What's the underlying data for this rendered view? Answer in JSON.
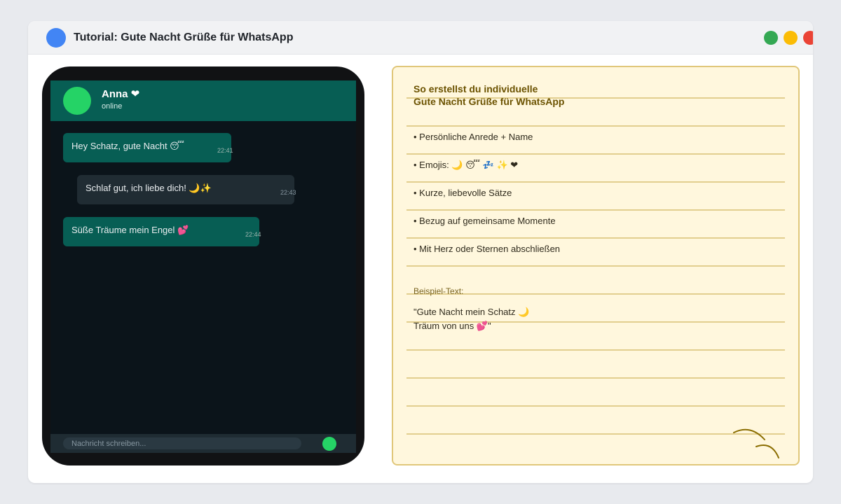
{
  "window": {
    "title": "Tutorial: Gute Nacht Grüße für WhatsApp",
    "colors": {
      "app_icon": "#4285f4",
      "green": "#34a853",
      "yellow": "#fbbc05",
      "red": "#ea4335"
    }
  },
  "chat": {
    "contact_name": "Anna ❤",
    "contact_status": "online",
    "messages": [
      {
        "text": "Hey Schatz, gute Nacht 😴",
        "time": "22:41",
        "direction": "outgoing"
      },
      {
        "text": "Schlaf gut, ich liebe dich! 🌙✨",
        "time": "22:43",
        "direction": "incoming"
      },
      {
        "text": "Süße Träume mein Engel 💕",
        "time": "22:44",
        "direction": "outgoing"
      }
    ],
    "input_placeholder": "Nachricht schreiben...",
    "colors": {
      "header": "#075e54",
      "avatar": "#25d366",
      "background": "#0b141a"
    }
  },
  "notebook": {
    "title_line1": "So erstellst du individuelle",
    "title_line2": "Gute Nacht Grüße für WhatsApp",
    "items": [
      "• Persönliche Anrede + Name",
      "• Emojis: 🌙 😴 💤 ✨ ❤",
      "• Kurze, liebevolle Sätze",
      "• Bezug auf gemeinsame Momente",
      "• Mit Herz oder Sternen abschließen"
    ],
    "example_label": "Beispiel-Text:",
    "example_line1": "\"Gute Nacht mein Schatz 🌙",
    "example_line2": "Träum von uns 💕\"",
    "colors": {
      "paper": "#fff7dd",
      "border": "#e0c77a",
      "title": "#6b5200"
    }
  }
}
